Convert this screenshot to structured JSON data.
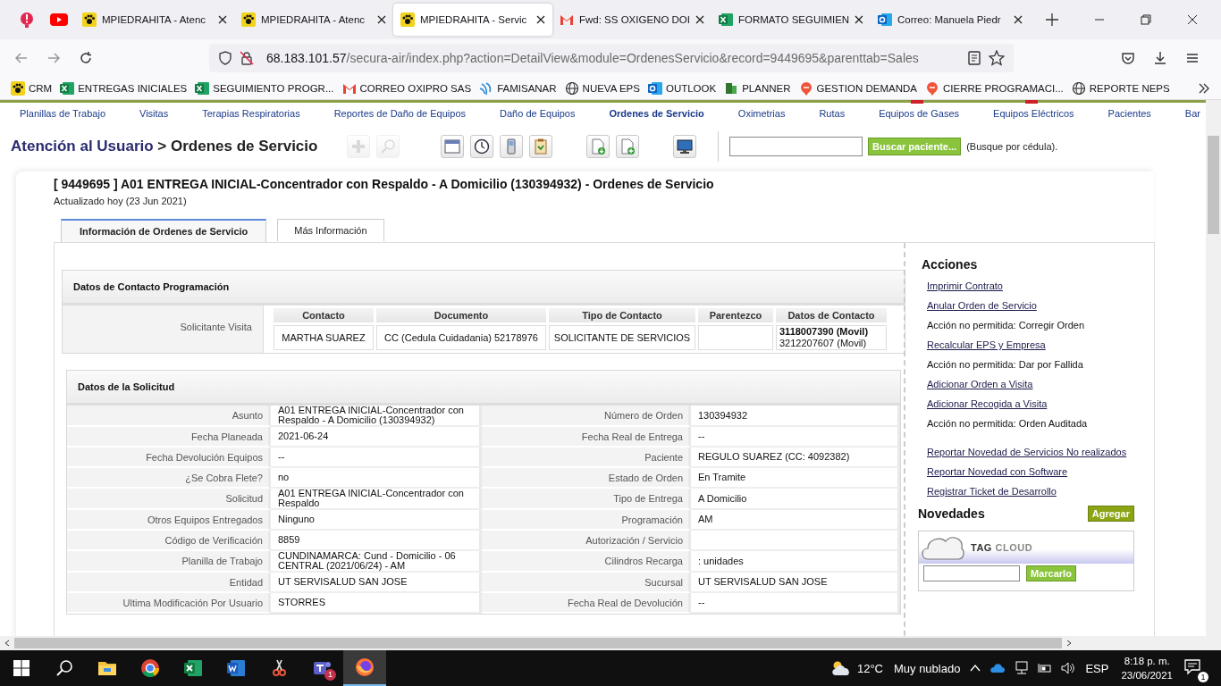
{
  "browser_tabs": [
    {
      "kind": "alert",
      "selected": false
    },
    {
      "kind": "youtube",
      "selected": false
    },
    {
      "kind": "paw",
      "title": "MPIEDRAHITA - Atenc",
      "selected": false
    },
    {
      "kind": "paw",
      "title": "MPIEDRAHITA - Atenc",
      "selected": false
    },
    {
      "kind": "paw",
      "title": "MPIEDRAHITA - Servic",
      "selected": true
    },
    {
      "kind": "gmail",
      "title": "Fwd: SS OXIGENO DOI",
      "selected": false
    },
    {
      "kind": "excel",
      "title": "FORMATO SEGUIMIEN",
      "selected": false
    },
    {
      "kind": "outlook",
      "title": "Correo: Manuela Piedr",
      "selected": false
    }
  ],
  "address": {
    "host": "68.183.101.57",
    "path": "/secura-air/index.php?action=DetailView&module=OrdenesServicio&record=9449695&parenttab=Sales"
  },
  "bookmarks": [
    {
      "kind": "paw",
      "label": "CRM"
    },
    {
      "kind": "excel",
      "label": "ENTREGAS INICIALES"
    },
    {
      "kind": "excel",
      "label": "SEGUIMIENTO PROGR..."
    },
    {
      "kind": "gmail",
      "label": "CORREO OXIPRO SAS"
    },
    {
      "kind": "famisanar",
      "label": "FAMISANAR"
    },
    {
      "kind": "globe",
      "label": "NUEVA EPS"
    },
    {
      "kind": "outlook",
      "label": "OUTLOOK"
    },
    {
      "kind": "planner",
      "label": "PLANNER"
    },
    {
      "kind": "pin",
      "label": "GESTION DEMANDA"
    },
    {
      "kind": "pin",
      "label": "CIERRE PROGRAMACI..."
    },
    {
      "kind": "globe",
      "label": "REPORTE NEPS"
    }
  ],
  "nav_menu": [
    {
      "label": "Planillas de Trabajo",
      "selected": false,
      "flag": false
    },
    {
      "label": "Visitas",
      "selected": false,
      "flag": false
    },
    {
      "label": "Terapias Respiratorias",
      "selected": false,
      "flag": false
    },
    {
      "label": "Reportes de Daño de Equipos",
      "selected": false,
      "flag": false
    },
    {
      "label": "Daño de Equipos",
      "selected": false,
      "flag": false
    },
    {
      "label": "Ordenes de Servicio",
      "selected": true,
      "flag": false
    },
    {
      "label": "Oximetrias",
      "selected": false,
      "flag": false
    },
    {
      "label": "Rutas",
      "selected": false,
      "flag": false
    },
    {
      "label": "Equipos de Gases",
      "selected": false,
      "flag": true
    },
    {
      "label": "Equipos Eléctricos",
      "selected": false,
      "flag": true
    },
    {
      "label": "Pacientes",
      "selected": false,
      "flag": false
    },
    {
      "label": "Bar",
      "selected": false,
      "flag": false
    }
  ],
  "breadcrumb": {
    "module": "Atención al Usuario",
    "separator": ">",
    "page": "Ordenes de Servicio"
  },
  "tool_groups": [
    {
      "tools": [
        {
          "kind": "plus",
          "disabled": true
        },
        {
          "kind": "magnifier",
          "disabled": true
        }
      ]
    },
    {
      "tools": [
        {
          "kind": "calendar",
          "disabled": false
        },
        {
          "kind": "clock",
          "disabled": false
        },
        {
          "kind": "phone",
          "disabled": false
        },
        {
          "kind": "clipboard",
          "disabled": false
        }
      ]
    },
    {
      "tools": [
        {
          "kind": "doc-down",
          "disabled": false
        },
        {
          "kind": "doc-add",
          "disabled": false
        }
      ]
    },
    {
      "tools": [
        {
          "kind": "monitor",
          "disabled": false
        }
      ]
    }
  ],
  "patient_search": {
    "button": "Buscar paciente...",
    "hint": "(Busque por cédula)."
  },
  "record": {
    "title": "[ 9449695 ] A01 ENTREGA INICIAL-Concentrador con Respaldo - A Domicilio (130394932) - Ordenes de Servicio",
    "updated": "Actualizado hoy (23 Jun 2021)"
  },
  "tabs": [
    {
      "label": "Información de Ordenes de Servicio",
      "selected": true
    },
    {
      "label": "Más Información",
      "selected": false
    }
  ],
  "contact_section": {
    "title": "Datos de Contacto Programación",
    "row_label": "Solicitante Visita",
    "columns": [
      "Contacto",
      "Documento",
      "Tipo de Contacto",
      "Parentezco",
      "Datos de Contacto"
    ],
    "contact": "MARTHA SUAREZ",
    "document": "CC (Cedula Cuidadania) 52178976",
    "type": "SOLICITANTE DE SERVICIOS",
    "phones": [
      {
        "text": "3118007390 (Movil)",
        "primary": true
      },
      {
        "text": "3212207607 (Movil)",
        "primary": false
      }
    ]
  },
  "request_section": {
    "title": "Datos de la Solicitud",
    "rows": [
      {
        "cells": [
          {
            "label": "Asunto",
            "value": "A01 ENTREGA INICIAL-Concentrador con Respaldo - A Domicilio (130394932)"
          },
          {
            "label": "Número de Orden",
            "value": "130394932"
          }
        ]
      },
      {
        "cells": [
          {
            "label": "Fecha Planeada",
            "value": "2021-06-24"
          },
          {
            "label": "Fecha Real de Entrega",
            "value": "--"
          }
        ]
      },
      {
        "cells": [
          {
            "label": "Fecha Devolución Equipos",
            "value": "--"
          },
          {
            "label": "Paciente",
            "value": "REGULO SUAREZ (CC: 4092382)"
          }
        ]
      },
      {
        "cells": [
          {
            "label": "¿Se Cobra Flete?",
            "value": "no"
          },
          {
            "label": "Estado de Orden",
            "value": "En Tramite"
          }
        ]
      },
      {
        "cells": [
          {
            "label": "Solicitud",
            "value": "A01 ENTREGA INICIAL-Concentrador con Respaldo"
          },
          {
            "label": "Tipo de Entrega",
            "value": "A Domicilio"
          }
        ]
      },
      {
        "cells": [
          {
            "label": "Otros Equipos Entregados",
            "value": "Ninguno"
          },
          {
            "label": "Programación",
            "value": "AM"
          }
        ]
      },
      {
        "cells": [
          {
            "label": "Código de Verificación",
            "value": "8859"
          },
          {
            "label": "Autorización / Servicio"
          }
        ]
      },
      {
        "cells": [
          {
            "label": "Planilla de Trabajo",
            "value": "CUNDINAMARCA: Cund - Domicilio - 06 CENTRAL (2021/06/24) - AM"
          },
          {
            "label": "Cilindros Recarga",
            "value": ": unidades"
          }
        ]
      },
      {
        "cells": [
          {
            "label": "Entidad",
            "value": "UT SERVISALUD SAN JOSE"
          },
          {
            "label": "Sucursal",
            "value": "UT SERVISALUD SAN JOSE"
          }
        ]
      },
      {
        "cells": [
          {
            "label": "Ultima Modificación Por Usuario",
            "value": "STORRES"
          },
          {
            "label": "Fecha Real de Devolución",
            "value": "--"
          }
        ]
      }
    ]
  },
  "actions": {
    "title": "Acciones",
    "items": [
      {
        "kind": "link",
        "label": "Imprimir Contrato"
      },
      {
        "kind": "link",
        "label": "Anular Orden de Servicio"
      },
      {
        "kind": "note",
        "label": "Acción no permitida: Corregir Orden"
      },
      {
        "kind": "link",
        "label": "Recalcular EPS y Empresa"
      },
      {
        "kind": "note",
        "label": "Acción no permitida: Dar por Fallida"
      },
      {
        "kind": "link",
        "label": "Adicionar Orden a Visita"
      },
      {
        "kind": "link",
        "label": "Adicionar Recogida a Visita"
      },
      {
        "kind": "note",
        "label": "Acción no permitida: Orden Auditada"
      }
    ],
    "reports": [
      {
        "kind": "link",
        "label": "Reportar Novedad de Servicios No realizados"
      },
      {
        "kind": "link",
        "label": "Reportar Novedad con Software"
      },
      {
        "kind": "link",
        "label": "Registrar Ticket de Desarrollo"
      }
    ]
  },
  "novedades": {
    "title": "Novedades",
    "button": "Agregar",
    "tag_word": "TAG",
    "cloud_word": "CLOUD",
    "tag_button": "Marcarlo"
  },
  "taskbar": {
    "apps": [
      {
        "kind": "start",
        "selected": false
      },
      {
        "kind": "search",
        "selected": false
      },
      {
        "kind": "explorer",
        "selected": false
      },
      {
        "kind": "chrome",
        "selected": false
      },
      {
        "kind": "excel",
        "selected": false
      },
      {
        "kind": "word",
        "selected": false
      },
      {
        "kind": "snip",
        "selected": false
      },
      {
        "kind": "teams",
        "selected": false,
        "badge": "1"
      },
      {
        "kind": "firefox",
        "selected": true
      }
    ],
    "temperature": "12°C",
    "weather": "Muy nublado",
    "language": "ESP",
    "time": "8:18 p. m.",
    "date": "23/06/2021",
    "notifications": "1"
  }
}
